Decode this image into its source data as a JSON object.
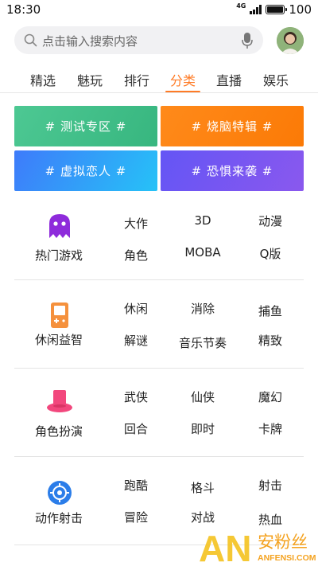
{
  "status_bar": {
    "time": "18:30",
    "network": "4G",
    "battery": "100"
  },
  "search": {
    "placeholder": "点击输入搜索内容"
  },
  "tabs": [
    {
      "label": "精选",
      "active": false
    },
    {
      "label": "魅玩",
      "active": false
    },
    {
      "label": "排行",
      "active": false
    },
    {
      "label": "分类",
      "active": true
    },
    {
      "label": "直播",
      "active": false
    },
    {
      "label": "娱乐",
      "active": false
    }
  ],
  "banners": [
    {
      "label": "# 测试专区 #",
      "color": "#3fbf88"
    },
    {
      "label": "# 烧脑特辑 #",
      "color": "#fd8310"
    },
    {
      "label": "# 虚拟恋人 #",
      "color": "#2fa3f8"
    },
    {
      "label": "# 恐惧来袭 #",
      "color": "#7756f1"
    }
  ],
  "categories": [
    {
      "name": "热门游戏",
      "icon": "ghost-icon",
      "icon_color": "#8e2bdb",
      "subs": [
        "大作",
        "3D",
        "动漫",
        "角色",
        "MOBA",
        "Q版"
      ]
    },
    {
      "name": "休闲益智",
      "icon": "gamepad-icon",
      "icon_color": "#f5913d",
      "subs": [
        "休闲",
        "消除",
        "捕鱼",
        "解谜",
        "音乐节奏",
        "精致"
      ]
    },
    {
      "name": "角色扮演",
      "icon": "hat-icon",
      "icon_color": "#f2477d",
      "subs": [
        "武侠",
        "仙侠",
        "魔幻",
        "回合",
        "即时",
        "卡牌"
      ]
    },
    {
      "name": "动作射击",
      "icon": "crosshair-icon",
      "icon_color": "#2b7de9",
      "subs": [
        "跑酷",
        "格斗",
        "射击",
        "冒险",
        "对战",
        "热血"
      ]
    }
  ],
  "watermark": {
    "logo": "AN",
    "chinese": "安粉丝",
    "english": "ANFENSI.COM"
  }
}
